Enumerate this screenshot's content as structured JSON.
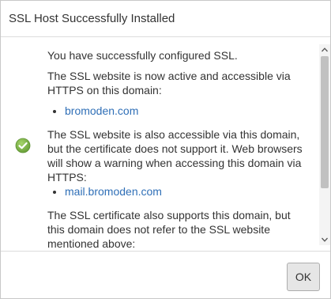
{
  "dialog": {
    "title": "SSL Host Successfully Installed",
    "status_icon": "check-circle-icon",
    "accent_color": "#7cb342",
    "link_color": "#2f6fb7",
    "message": {
      "intro": "You have successfully configured SSL.",
      "active_text": "The SSL website is now active and accessible via HTTPS on this domain:",
      "primary_domain": "bromoden.com",
      "also_accessible_text": "The SSL website is also accessible via this domain, but the certificate does not support it. Web browsers will show a warning when accessing this domain via HTTPS:",
      "secondary_domain": "mail.bromoden.com",
      "supports_text": "The SSL certificate also supports this domain, but this domain does not refer to the SSL website mentioned above:"
    },
    "ok_label": "OK"
  }
}
